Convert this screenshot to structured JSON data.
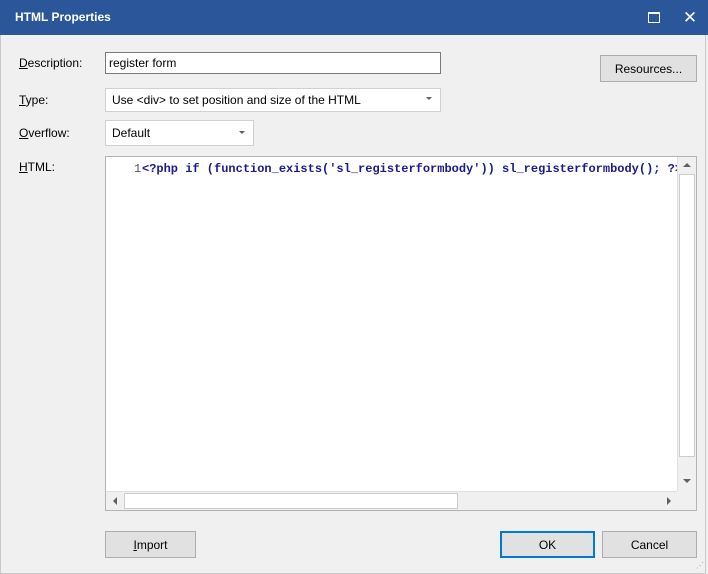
{
  "window": {
    "title": "HTML Properties"
  },
  "form": {
    "description": {
      "label": "Description:",
      "mnemonic": "D",
      "value": "register form"
    },
    "type": {
      "label": "Type:",
      "mnemonic": "T",
      "value": "Use <div> to set position and size of the HTML"
    },
    "overflow": {
      "label": "Overflow:",
      "mnemonic": "O",
      "value": "Default"
    },
    "html": {
      "label": "HTML:",
      "mnemonic": "H",
      "line_number": "1",
      "code": "<?php if (function_exists('sl_registerformbody')) sl_registerformbody(); ?>"
    }
  },
  "buttons": {
    "resources": "Resources...",
    "import": "Import",
    "ok": "OK",
    "cancel": "Cancel"
  },
  "icons": {
    "maximize": "maximize-icon",
    "close": "close-icon",
    "close_glyph": "✕"
  }
}
